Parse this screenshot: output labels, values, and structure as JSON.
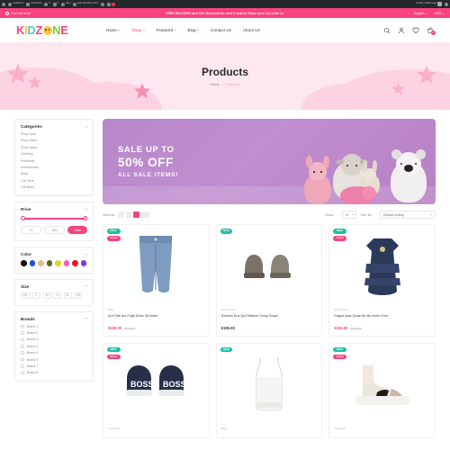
{
  "adminbar": {
    "items": [
      {
        "icon": "wordpress-icon",
        "label": ""
      },
      {
        "icon": "home-icon",
        "label": "re:kidzone"
      },
      {
        "icon": "pencil-icon",
        "label": "Customize"
      },
      {
        "icon": "refresh-icon",
        "label": "3"
      },
      {
        "icon": "comment-icon",
        "label": "0"
      },
      {
        "icon": "plus-icon",
        "label": "New"
      },
      {
        "icon": "elementor-icon",
        "label": "Edit with Elementor"
      },
      {
        "icon": "move-icon",
        "label": ""
      },
      {
        "icon": "facebook-icon",
        "label": ""
      },
      {
        "icon": "alert-icon",
        "label": "0"
      }
    ],
    "howdy": "Howdy, wpthemego"
  },
  "topbar": {
    "find_more": "Find out more",
    "promo": "FREE DELIVERY and 40% Discount for next 3 orders! Place your 1st order in.",
    "language": "English",
    "currency": "USD"
  },
  "header": {
    "logo": {
      "l1": "K",
      "l2": "I",
      "l3": "D",
      "l4": "Z",
      "o": "O",
      "l5": "N",
      "l6": "E"
    },
    "nav": [
      {
        "label": "Home",
        "caret": true,
        "active": false
      },
      {
        "label": "Shop",
        "caret": true,
        "active": true
      },
      {
        "label": "Featured",
        "caret": true,
        "active": false
      },
      {
        "label": "Blog",
        "caret": true,
        "active": false
      },
      {
        "label": "Contact Us",
        "caret": false,
        "active": false
      },
      {
        "label": "About Us",
        "caret": false,
        "active": false
      }
    ],
    "icons": [
      {
        "name": "search-icon"
      },
      {
        "name": "user-icon"
      },
      {
        "name": "heart-icon"
      },
      {
        "name": "cart-icon"
      }
    ],
    "cart_count": "1"
  },
  "hero": {
    "title": "Products",
    "breadcrumb": {
      "home": "Home",
      "sep": "›",
      "current": "Products"
    }
  },
  "sidebar": {
    "categories": {
      "title": "Categories",
      "items": [
        "Shop Girls",
        "Shop Baby",
        "Shop Boys",
        "Clothing",
        "Footwear",
        "Accessories",
        "Baby",
        "Car Seat",
        "Gift Baby"
      ]
    },
    "price": {
      "title": "Price",
      "min": "70",
      "max": "650",
      "filter_label": "Filter"
    },
    "color": {
      "title": "Color",
      "swatches": [
        "#111111",
        "#1d4fd8",
        "#dcc08c",
        "#4d6b18",
        "#edcf20",
        "#f060c4",
        "#e01f1f",
        "#8b30e0"
      ]
    },
    "size": {
      "title": "Size",
      "options": [
        "2XL",
        "L",
        "M",
        "S",
        "XL",
        "XS"
      ]
    },
    "brands": {
      "title": "Brands",
      "items": [
        "Brand 1",
        "Brand 2",
        "Brand 3",
        "Brand 4",
        "Brand 5",
        "Brand 6",
        "Brand 7",
        "Brand 8"
      ]
    }
  },
  "promo_banner": {
    "line1": "SALE UP TO",
    "line2": "50% OFF",
    "line3": "ALL SALE ITEMS!"
  },
  "toolbar": {
    "view_as_label": "View As",
    "show_label": "Show",
    "show_value": "12",
    "sort_label": "Sort By",
    "sort_value": "Default sorting"
  },
  "products": [
    {
      "category": "Baby",
      "name": "Aut Odit Aut Fugit Dolor Sit Amet",
      "price": "$180.00",
      "old_price": "$220.00",
      "badges": [
        "NEW",
        "SALE"
      ],
      "image": "blue-denim-joggers"
    },
    {
      "category": "Accessories",
      "name": "Dolores Eos Qui Ratione Volup Sequi",
      "price": "$195.00",
      "old_price": "",
      "badges": [
        "NEW"
      ],
      "image": "grey-suede-boots"
    },
    {
      "category": "Accessories",
      "name": "Eaque Ipsa Quae Ab Illo Inven Tore",
      "price": "$150.00",
      "old_price": "$190.00",
      "badges": [
        "NEW",
        "SALE"
      ],
      "image": "navy-ruffle-dress"
    },
    {
      "category": "Footwear",
      "name": "",
      "price": "",
      "old_price": "",
      "badges": [
        "NEW",
        "SALE"
      ],
      "image": "navy-boss-sneakers"
    },
    {
      "category": "Baby",
      "name": "",
      "price": "",
      "old_price": "",
      "badges": [
        "NEW"
      ],
      "image": "white-crop-top"
    },
    {
      "category": "Footwear",
      "name": "",
      "price": "",
      "old_price": "",
      "badges": [
        "NEW",
        "SALE"
      ],
      "image": "beige-sock-sneaker"
    }
  ],
  "colors": {
    "brand_pink": "#f8437f",
    "badge_new": "#1fbfa4",
    "hero_bg": "#fde7f0",
    "banner_purple": "#b887c9"
  }
}
